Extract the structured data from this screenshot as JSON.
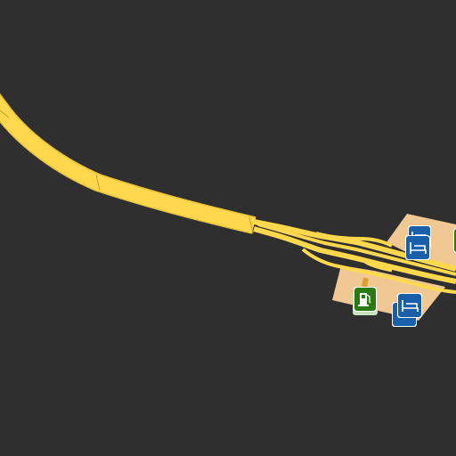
{
  "map": {
    "background_color": "#2f2f2f",
    "road_color": "#ffd84d",
    "road_casing_color": "#e8bf3a",
    "service_area_color": "#f0c894",
    "fuel_marker_color": "#2a7a12",
    "lodging_marker_color": "#1a5faa",
    "markers": [
      {
        "type": "lodging",
        "icon": "bed-icon"
      },
      {
        "type": "lodging",
        "icon": "bed-icon"
      },
      {
        "type": "fuel",
        "icon": "fuel-pump-icon"
      },
      {
        "type": "lodging",
        "icon": "bed-icon"
      },
      {
        "type": "fuel",
        "icon": "fuel-pump-icon"
      }
    ]
  }
}
